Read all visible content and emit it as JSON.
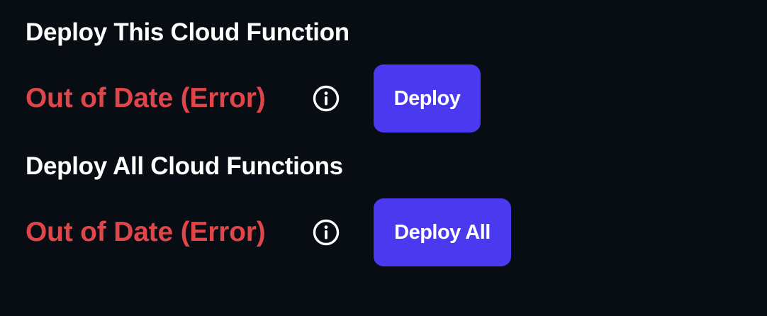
{
  "colors": {
    "background": "#080d14",
    "title_text": "#ffffff",
    "error_text": "#df4549",
    "button_bg": "#4b39ef",
    "button_text": "#ffffff"
  },
  "single": {
    "title": "Deploy This Cloud Function",
    "status": "Out of Date (Error)",
    "info_icon": "info-circle-icon",
    "button_label": "Deploy"
  },
  "all": {
    "title": "Deploy All Cloud Functions",
    "status": "Out of Date (Error)",
    "info_icon": "info-circle-icon",
    "button_label": "Deploy All"
  }
}
